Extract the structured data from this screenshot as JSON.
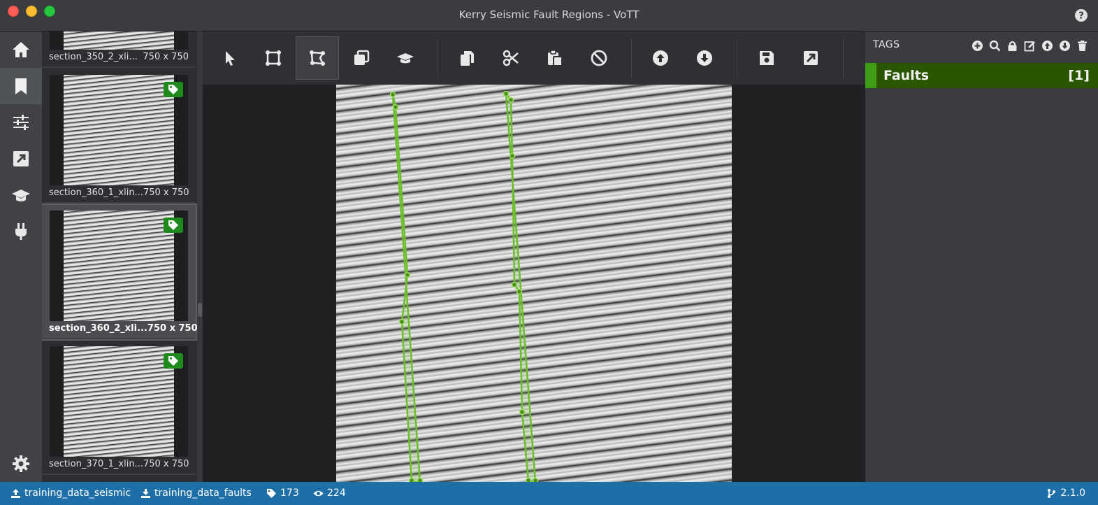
{
  "window": {
    "title": "Kerry Seismic Fault Regions - VoTT"
  },
  "sidebar": {
    "items": [
      {
        "icon": "home-icon",
        "active": false
      },
      {
        "icon": "bookmark-icon",
        "active": true
      },
      {
        "icon": "sliders-icon",
        "active": false
      },
      {
        "icon": "export-icon",
        "active": false
      },
      {
        "icon": "graduation-cap-icon",
        "active": false
      },
      {
        "icon": "plug-icon",
        "active": false
      },
      {
        "icon": "gear-icon",
        "active": false
      }
    ]
  },
  "thumbnails": [
    {
      "name": "section_350_2_xli...",
      "size": "750 x 750",
      "tagged": false,
      "selected": false
    },
    {
      "name": "section_360_1_xlin...",
      "size": "750 x 750",
      "tagged": true,
      "selected": false
    },
    {
      "name": "section_360_2_xli...",
      "size": "750 x 750",
      "tagged": true,
      "selected": true
    },
    {
      "name": "section_370_1_xlin...",
      "size": "750 x 750",
      "tagged": true,
      "selected": false
    }
  ],
  "toolbar": {
    "tools": [
      "pointer-icon",
      "rectangle-icon",
      "polygon-icon",
      "copy-rectangle-icon",
      "active-learning-icon",
      "copy-icon",
      "cut-icon",
      "paste-icon",
      "clear-icon",
      "previous-asset-icon",
      "next-asset-icon",
      "save-icon",
      "export-icon"
    ],
    "active_tool": "polygon-icon"
  },
  "tags_panel": {
    "header": "TAGS",
    "tags": [
      {
        "name": "Faults",
        "count": "[1]",
        "color": "#3f9e16"
      }
    ]
  },
  "statusbar": {
    "source_connection": "training_data_seismic",
    "target_connection": "training_data_faults",
    "tagged_count": "173",
    "visited_count": "224",
    "version": "2.1.0"
  },
  "colors": {
    "accent": "#1e6ea7",
    "tag_green": "#3f9e16",
    "region_stroke": "#6bbf2a"
  }
}
